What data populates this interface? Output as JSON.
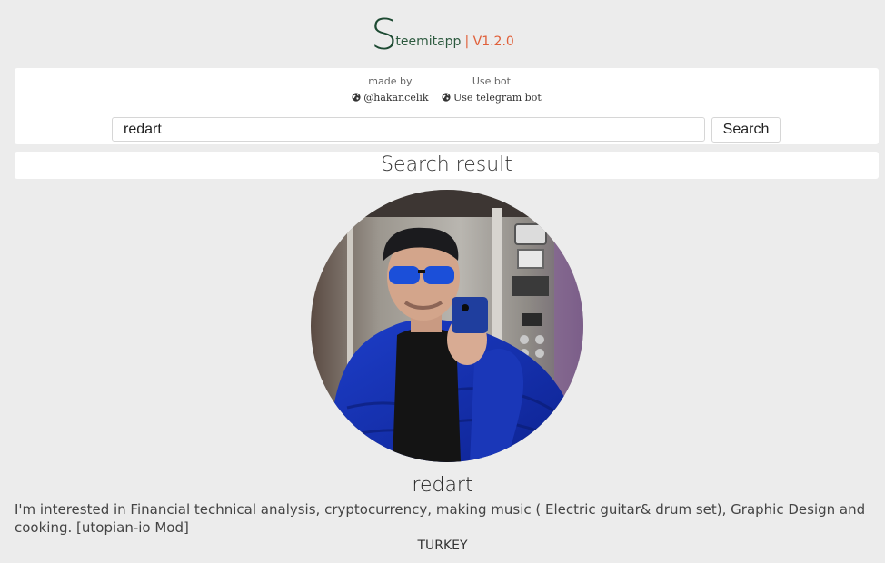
{
  "header": {
    "logo_letter": "S",
    "logo_rest": "teemitapp",
    "version": "| V1.2.0"
  },
  "credits": [
    {
      "label": "made by",
      "link": "@hakancelik",
      "icon": "globe-icon"
    },
    {
      "label": "Use bot",
      "link": "Use telegram bot",
      "icon": "globe-icon"
    }
  ],
  "search": {
    "value": "redart",
    "button_label": "Search"
  },
  "result": {
    "title": "Search result"
  },
  "profile": {
    "username": "redart",
    "bio": "I'm interested in Financial technical analysis, cryptocurrency, making music ( Electric guitar& drum set), Graphic Design and cooking. [utopian-io Mod]",
    "country": "TURKEY"
  },
  "colors": {
    "background": "#ececec",
    "logo_green": "#1d4a32",
    "version_orange": "#e0603a",
    "panel": "#ffffff"
  }
}
